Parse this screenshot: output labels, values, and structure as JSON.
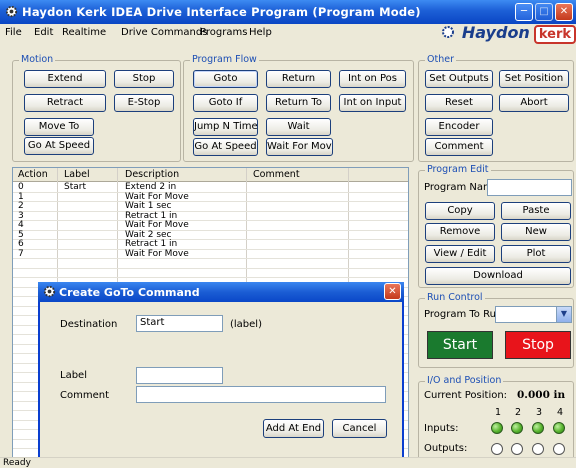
{
  "window": {
    "title": "Haydon Kerk IDEA Drive Interface Program (Program Mode)"
  },
  "menu": {
    "items": [
      "File",
      "Edit",
      "Realtime",
      "Drive Commands",
      "Programs",
      "Help"
    ],
    "brand": "Haydon",
    "brand_box": "kerk"
  },
  "motion": {
    "title": "Motion",
    "buttons": [
      "Extend",
      "Stop",
      "Retract",
      "E-Stop",
      "Move To",
      "Go At Speed"
    ]
  },
  "program_flow": {
    "title": "Program Flow",
    "buttons": [
      "Goto",
      "Return",
      "Int on Pos",
      "Goto If",
      "Return To",
      "Int on Input",
      "Jump N Times",
      "Wait",
      "Go At Speed",
      "Wait For Move"
    ]
  },
  "other": {
    "title": "Other",
    "buttons": [
      "Set Outputs",
      "Set Position",
      "Reset",
      "Abort",
      "Encoder",
      "Comment"
    ]
  },
  "table": {
    "headers": [
      "Action",
      "Label",
      "Description",
      "Comment"
    ],
    "rows": [
      {
        "action": "0",
        "label": "Start",
        "description": "Extend 2 in",
        "comment": ""
      },
      {
        "action": "1",
        "label": "",
        "description": "Wait For Move",
        "comment": ""
      },
      {
        "action": "2",
        "label": "",
        "description": "Wait 1 sec",
        "comment": ""
      },
      {
        "action": "3",
        "label": "",
        "description": "Retract 1 in",
        "comment": ""
      },
      {
        "action": "4",
        "label": "",
        "description": "Wait For Move",
        "comment": ""
      },
      {
        "action": "5",
        "label": "",
        "description": "Wait 2 sec",
        "comment": ""
      },
      {
        "action": "6",
        "label": "",
        "description": "Retract 1 in",
        "comment": ""
      },
      {
        "action": "7",
        "label": "",
        "description": "Wait For Move",
        "comment": ""
      }
    ]
  },
  "program_edit": {
    "title": "Program Edit",
    "name_label": "Program Name:",
    "name_value": "",
    "buttons": [
      "Copy",
      "Paste",
      "Remove",
      "New",
      "View / Edit",
      "Plot",
      "Download"
    ]
  },
  "run_control": {
    "title": "Run Control",
    "program_label": "Program To Run:",
    "program_value": "",
    "start": "Start",
    "stop": "Stop",
    "start_color": "#1a7a2e",
    "stop_color": "#e8141b"
  },
  "io": {
    "title": "I/O and Position",
    "position_label": "Current Position:",
    "position_value": "0.000 in",
    "channels": [
      "1",
      "2",
      "3",
      "4"
    ],
    "inputs_label": "Inputs:",
    "outputs_label": "Outputs:",
    "inputs_state": [
      true,
      true,
      true,
      true
    ],
    "outputs_state": [
      false,
      false,
      false,
      false
    ]
  },
  "dialog": {
    "title": "Create GoTo Command",
    "destination_label": "Destination",
    "destination_value": "Start",
    "destination_hint": "(label)",
    "label_label": "Label",
    "label_value": "",
    "comment_label": "Comment",
    "comment_value": "",
    "add_button": "Add At End",
    "cancel_button": "Cancel"
  },
  "status": {
    "text": "Ready"
  }
}
